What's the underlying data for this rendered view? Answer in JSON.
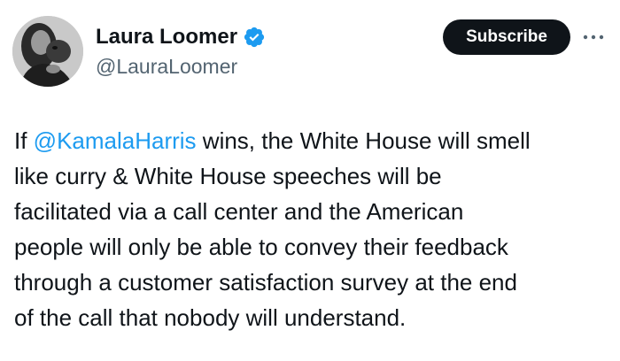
{
  "author": {
    "display_name": "Laura Loomer",
    "handle": "@LauraLoomer",
    "verified_icon": "verified-badge-icon",
    "avatar": "profile-photo"
  },
  "actions": {
    "subscribe_label": "Subscribe",
    "more_icon": "more-horizontal-icon"
  },
  "tweet": {
    "text_prefix": "If ",
    "mention": "@KamalaHarris",
    "line_1_rest": " wins, the White House will smell",
    "line_2": "like curry & White House speeches will be",
    "line_3": "facilitated via a call center and the American",
    "line_4": "people will only be able to convey their feedback",
    "line_5": "through a customer satisfaction survey at the end",
    "line_6": "of the call that nobody will understand."
  },
  "colors": {
    "text": "#0f1419",
    "secondary_text": "#536471",
    "link": "#1d9bf0",
    "verified_blue": "#1d9bf0",
    "button_bg": "#0f1419",
    "button_text": "#ffffff"
  }
}
